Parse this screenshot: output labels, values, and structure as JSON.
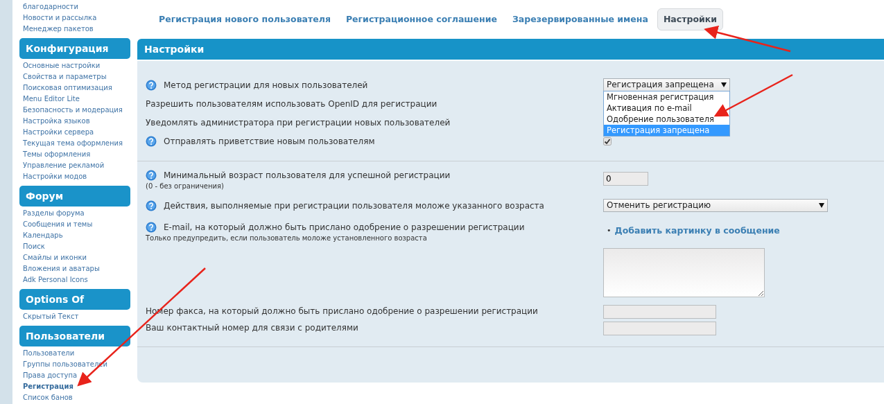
{
  "sidebar": {
    "top_items": [
      {
        "label": "благодарности",
        "selected": false
      },
      {
        "label": "Новости и рассылка",
        "selected": false
      },
      {
        "label": "Менеджер пакетов",
        "selected": false
      }
    ],
    "sections": [
      {
        "title": "Конфигурация",
        "items": [
          {
            "label": "Основные настройки",
            "selected": false
          },
          {
            "label": "Свойства и параметры",
            "selected": false
          },
          {
            "label": "Поисковая оптимизация",
            "selected": false
          },
          {
            "label": "Menu Editor Lite",
            "selected": false
          },
          {
            "label": "Безопасность и модерация",
            "selected": false
          },
          {
            "label": "Настройка языков",
            "selected": false
          },
          {
            "label": "Настройки сервера",
            "selected": false
          },
          {
            "label": "Текущая тема оформления",
            "selected": false
          },
          {
            "label": "Темы оформления",
            "selected": false
          },
          {
            "label": "Управление рекламой",
            "selected": false
          },
          {
            "label": "Настройки модов",
            "selected": false
          }
        ]
      },
      {
        "title": "Форум",
        "items": [
          {
            "label": "Разделы форума",
            "selected": false
          },
          {
            "label": "Сообщения и темы",
            "selected": false
          },
          {
            "label": "Календарь",
            "selected": false
          },
          {
            "label": "Поиск",
            "selected": false
          },
          {
            "label": "Смайлы и иконки",
            "selected": false
          },
          {
            "label": "Вложения и аватары",
            "selected": false
          },
          {
            "label": "Adk Personal Icons",
            "selected": false
          }
        ]
      },
      {
        "title": "Options Of",
        "items": [
          {
            "label": "Скрытый Текст",
            "selected": false
          }
        ]
      },
      {
        "title": "Пользователи",
        "items": [
          {
            "label": "Пользователи",
            "selected": false
          },
          {
            "label": "Группы пользователей",
            "selected": false
          },
          {
            "label": "Права доступа",
            "selected": false
          },
          {
            "label": "Регистрация",
            "selected": true
          },
          {
            "label": "Список банов",
            "selected": false
          }
        ]
      }
    ]
  },
  "tabs": [
    {
      "label": "Регистрация нового пользователя",
      "selected": false
    },
    {
      "label": "Регистрационное соглашение",
      "selected": false
    },
    {
      "label": "Зарезервированные имена",
      "selected": false
    },
    {
      "label": "Настройки",
      "selected": true
    }
  ],
  "panel": {
    "title": "Настройки",
    "groups": [
      [
        {
          "label": "Метод регистрации для новых пользователей",
          "help": true,
          "control": {
            "kind": "select",
            "value": "Регистрация запрещена",
            "expanded": true,
            "options": [
              {
                "label": "Мгновенная регистрация",
                "selected": false
              },
              {
                "label": "Активация по e-mail",
                "selected": false
              },
              {
                "label": "Одобрение пользователя",
                "selected": false
              },
              {
                "label": "Регистрация запрещена",
                "selected": true
              }
            ]
          }
        },
        {
          "label": "Разрешить пользователям использовать OpenID для регистрации",
          "help": false
        },
        {
          "label": "Уведомлять администратора при регистрации новых пользователей",
          "help": false
        },
        {
          "label": "Отправлять приветствие новым пользователям",
          "help": true,
          "control": {
            "kind": "checkbox",
            "checked": true
          }
        }
      ],
      [
        {
          "label": "Минимальный возраст пользователя для успешной регистрации",
          "note": "(0 - без ограничения)",
          "help": true,
          "control": {
            "kind": "number",
            "value": "0"
          }
        },
        {
          "label": "Действия, выполняемые при регистрации пользователя моложе указанного возраста",
          "help": true,
          "control": {
            "kind": "select",
            "value": "Отменить регистрацию",
            "expanded": false
          }
        },
        {
          "label": "E-mail, на который должно быть прислано одобрение о разрешении регистрации",
          "note": "Только предупредить, если пользователь моложе установленного возраста",
          "help": true,
          "control": {
            "kind": "textarea",
            "bullet": "•",
            "link": "Добавить картинку в сообщение"
          }
        },
        {
          "label": "Номер факса, на который должно быть прислано одобрение о разрешении регистрации",
          "help": false,
          "control": {
            "kind": "text"
          }
        },
        {
          "label": "Ваш контактный номер для связи с родителями",
          "help": false,
          "control": {
            "kind": "text"
          }
        }
      ]
    ]
  }
}
